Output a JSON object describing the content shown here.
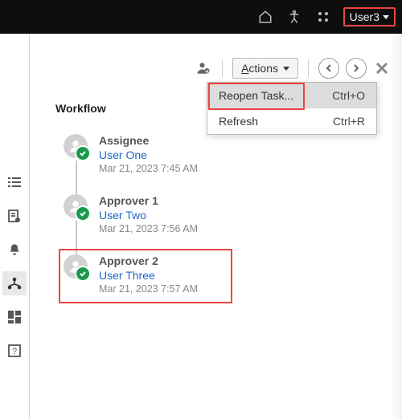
{
  "header": {
    "user_label": "User3"
  },
  "toolbar": {
    "actions_label": "Actions"
  },
  "actions_menu": {
    "items": [
      {
        "label": "Reopen Task...",
        "shortcut": "Ctrl+O"
      },
      {
        "label": "Refresh",
        "shortcut": "Ctrl+R"
      }
    ]
  },
  "workflow": {
    "title": "Workflow",
    "steps": [
      {
        "role": "Assignee",
        "user": "User One",
        "ts": "Mar 21, 2023 7:45 AM"
      },
      {
        "role": "Approver 1",
        "user": "User Two",
        "ts": "Mar 21, 2023 7:56 AM"
      },
      {
        "role": "Approver 2",
        "user": "User Three",
        "ts": "Mar 21, 2023 7:57 AM"
      }
    ]
  }
}
